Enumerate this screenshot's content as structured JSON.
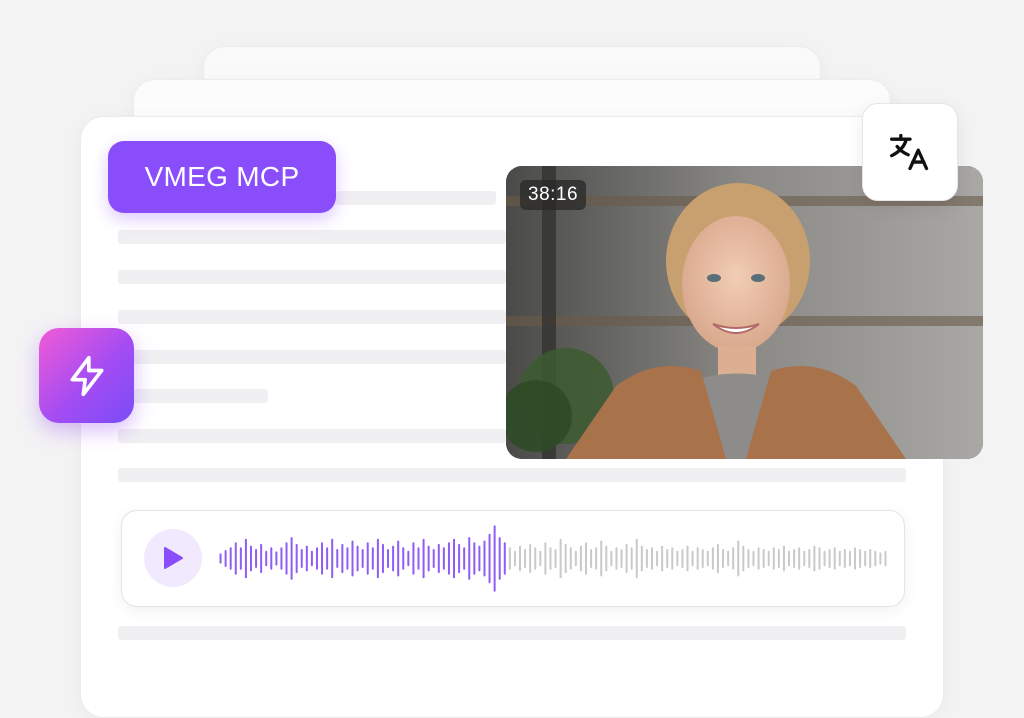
{
  "badge": {
    "label": "VMEG MCP"
  },
  "video": {
    "timecode": "38:16"
  },
  "icons": {
    "bolt": "lightning-icon",
    "translate": "translate-icon",
    "play": "play-icon"
  },
  "colors": {
    "accent": "#8a4dfc",
    "played": "#8f5cf5",
    "unplayed": "#c9c9cc",
    "background": "#f3f3f4"
  },
  "audio": {
    "progress": 0.43,
    "levels": [
      0.12,
      0.22,
      0.3,
      0.45,
      0.3,
      0.55,
      0.35,
      0.25,
      0.4,
      0.2,
      0.3,
      0.18,
      0.3,
      0.45,
      0.6,
      0.4,
      0.25,
      0.35,
      0.2,
      0.3,
      0.45,
      0.3,
      0.55,
      0.25,
      0.4,
      0.3,
      0.5,
      0.35,
      0.25,
      0.45,
      0.3,
      0.55,
      0.4,
      0.25,
      0.35,
      0.5,
      0.3,
      0.2,
      0.45,
      0.3,
      0.55,
      0.35,
      0.25,
      0.4,
      0.3,
      0.45,
      0.55,
      0.4,
      0.3,
      0.6,
      0.45,
      0.35,
      0.5,
      0.7,
      0.95,
      0.6,
      0.45,
      0.3,
      0.2,
      0.35,
      0.25,
      0.4,
      0.3,
      0.2,
      0.45,
      0.3,
      0.25,
      0.55,
      0.4,
      0.3,
      0.2,
      0.35,
      0.45,
      0.25,
      0.3,
      0.5,
      0.35,
      0.2,
      0.3,
      0.25,
      0.4,
      0.3,
      0.55,
      0.35,
      0.25,
      0.3,
      0.2,
      0.35,
      0.25,
      0.3,
      0.2,
      0.25,
      0.35,
      0.2,
      0.3,
      0.25,
      0.2,
      0.3,
      0.4,
      0.25,
      0.2,
      0.3,
      0.5,
      0.35,
      0.25,
      0.2,
      0.3,
      0.25,
      0.2,
      0.3,
      0.25,
      0.35,
      0.2,
      0.25,
      0.3,
      0.2,
      0.25,
      0.35,
      0.3,
      0.2,
      0.25,
      0.3,
      0.2,
      0.25,
      0.2,
      0.3,
      0.25,
      0.2,
      0.25,
      0.2,
      0.15,
      0.2
    ]
  }
}
